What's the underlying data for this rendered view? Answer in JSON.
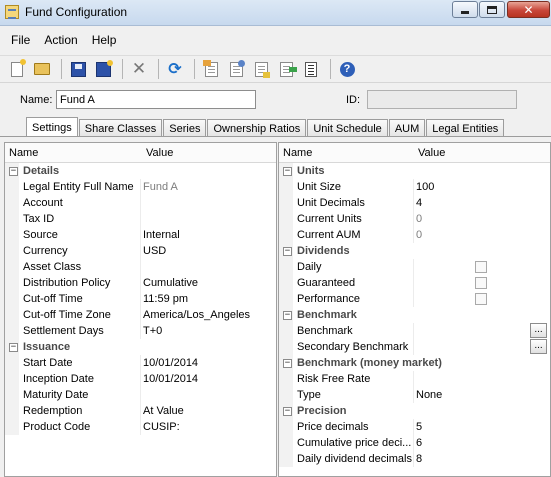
{
  "window": {
    "title": "Fund Configuration"
  },
  "menu": [
    "File",
    "Action",
    "Help"
  ],
  "toolbar": {
    "icons": [
      "new-icon",
      "open-folder-icon",
      "save-icon",
      "save-all-icon",
      "delete-icon",
      "refresh-icon",
      "doc-settings-icon",
      "doc-user-icon",
      "doc-copy-icon",
      "doc-export-icon",
      "list-icon",
      "help-icon"
    ]
  },
  "form": {
    "name_label": "Name:",
    "name_value": "Fund A",
    "id_label": "ID:",
    "id_value": ""
  },
  "tabs": [
    {
      "label": "Settings",
      "active": true
    },
    {
      "label": "Share Classes"
    },
    {
      "label": "Series"
    },
    {
      "label": "Ownership Ratios"
    },
    {
      "label": "Unit Schedule"
    },
    {
      "label": "AUM"
    },
    {
      "label": "Legal Entities"
    }
  ],
  "left_grid": {
    "headers": {
      "name": "Name",
      "value": "Value"
    },
    "rows": [
      {
        "type": "cat",
        "name": "Details"
      },
      {
        "name": "Legal Entity Full Name",
        "value": "Fund A",
        "gray": true
      },
      {
        "name": "Account",
        "value": ""
      },
      {
        "name": "Tax ID",
        "value": ""
      },
      {
        "name": "Source",
        "value": "Internal"
      },
      {
        "name": "Currency",
        "value": "USD"
      },
      {
        "name": "Asset Class",
        "value": ""
      },
      {
        "name": "Distribution Policy",
        "value": "Cumulative"
      },
      {
        "name": "Cut-off Time",
        "value": "11:59 pm"
      },
      {
        "name": "Cut-off Time Zone",
        "value": "America/Los_Angeles"
      },
      {
        "name": "Settlement Days",
        "value": "T+0"
      },
      {
        "type": "cat",
        "name": "Issuance"
      },
      {
        "name": "Start Date",
        "value": "10/01/2014"
      },
      {
        "name": "Inception Date",
        "value": "10/01/2014"
      },
      {
        "name": "Maturity Date",
        "value": ""
      },
      {
        "name": "Redemption",
        "value": "At Value"
      },
      {
        "name": "Product Code",
        "value": "CUSIP:"
      }
    ]
  },
  "right_grid": {
    "headers": {
      "name": "Name",
      "value": "Value"
    },
    "ellipsis": "...",
    "rows": [
      {
        "type": "cat",
        "name": "Units"
      },
      {
        "name": "Unit Size",
        "value": "100"
      },
      {
        "name": "Unit Decimals",
        "value": "4"
      },
      {
        "name": "Current Units",
        "value": "0",
        "gray": true
      },
      {
        "name": "Current AUM",
        "value": "0",
        "gray": true
      },
      {
        "type": "cat",
        "name": "Dividends"
      },
      {
        "name": "Daily",
        "value": "",
        "kind": "checkbox"
      },
      {
        "name": "Guaranteed",
        "value": "",
        "kind": "checkbox"
      },
      {
        "name": "Performance",
        "value": "",
        "kind": "checkbox"
      },
      {
        "type": "cat",
        "name": "Benchmark"
      },
      {
        "name": "Benchmark",
        "value": "",
        "kind": "ellipsis"
      },
      {
        "name": "Secondary Benchmark",
        "value": "",
        "kind": "ellipsis"
      },
      {
        "type": "cat",
        "name": "Benchmark (money market)"
      },
      {
        "name": "Risk Free Rate",
        "value": ""
      },
      {
        "name": "Type",
        "value": "None"
      },
      {
        "type": "cat",
        "name": "Precision"
      },
      {
        "name": "Price decimals",
        "value": "5"
      },
      {
        "name": "Cumulative price deci...",
        "value": "6"
      },
      {
        "name": "Daily dividend decimals",
        "value": "8"
      }
    ]
  }
}
